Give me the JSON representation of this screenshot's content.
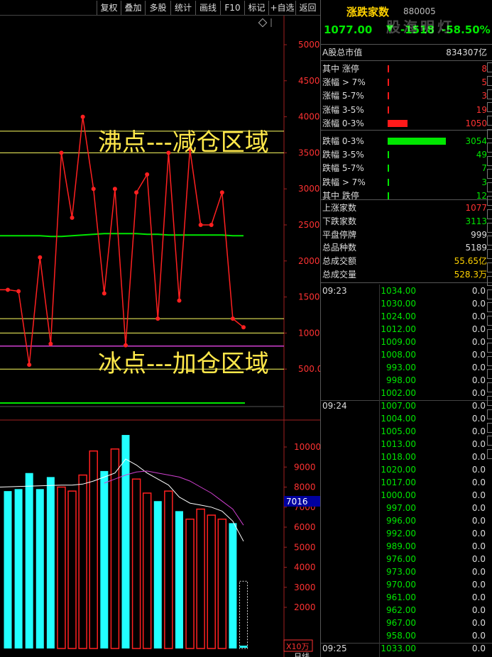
{
  "toolbar": {
    "buttons": [
      "复权",
      "叠加",
      "多股",
      "统计",
      "画线",
      "F10",
      "标记",
      "+自选",
      "返回"
    ]
  },
  "chart": {
    "upper_axis": [
      "5000",
      "4500",
      "4000",
      "3500",
      "3000",
      "2500",
      "2000",
      "1500",
      "1000",
      "500.0"
    ],
    "lower_axis": [
      "10000",
      "9000",
      "8000",
      "7000",
      "6000",
      "5000",
      "4000",
      "3000",
      "2000"
    ],
    "cursor_value": "7016",
    "lower_unit": "X10万",
    "boil_label": "沸点---减仓区域",
    "ice_label": "冰点---加仓区域",
    "bottom_corner": "日线",
    "diamond_icon": "diamond-icon",
    "colors": {
      "price_line": "#ff2020",
      "ma_line": "#00e600",
      "up_bar": "#ff2020",
      "down_bar": "#22ffff",
      "ref_line": "#ffff60",
      "ice_line": "#d040d0",
      "annotation": "#ffe84a"
    }
  },
  "chart_data": {
    "type": "line",
    "title": "",
    "price_series": [
      1600,
      1580,
      560,
      2050,
      850,
      3500,
      2600,
      4000,
      3000,
      1550,
      3000,
      830,
      2950,
      3200,
      1200,
      3500,
      1450,
      3550,
      2500,
      2500,
      2950,
      1200,
      1080
    ],
    "ma_series": [
      2350,
      2350,
      2350,
      2350,
      2340,
      2340,
      2350,
      2360,
      2370,
      2380,
      2380,
      2380,
      2380,
      2370,
      2370,
      2360,
      2360,
      2360,
      2360,
      2360,
      2360,
      2350,
      2350
    ],
    "ref_lines": [
      3800,
      3500,
      1200,
      1000,
      500
    ],
    "ice_line_value": 820,
    "upper_ylim": [
      0,
      5400
    ],
    "volume_bars": [
      {
        "v": 7800,
        "up": false
      },
      {
        "v": 7900,
        "up": false
      },
      {
        "v": 8700,
        "up": false
      },
      {
        "v": 7900,
        "up": false
      },
      {
        "v": 8500,
        "up": false
      },
      {
        "v": 8000,
        "up": true
      },
      {
        "v": 7800,
        "up": true
      },
      {
        "v": 8600,
        "up": true
      },
      {
        "v": 9800,
        "up": true
      },
      {
        "v": 8800,
        "up": false
      },
      {
        "v": 9900,
        "up": true
      },
      {
        "v": 10600,
        "up": false
      },
      {
        "v": 8400,
        "up": true
      },
      {
        "v": 7700,
        "up": true
      },
      {
        "v": 7300,
        "up": false
      },
      {
        "v": 7800,
        "up": true
      },
      {
        "v": 6800,
        "up": false
      },
      {
        "v": 6400,
        "up": true
      },
      {
        "v": 6900,
        "up": true
      },
      {
        "v": 6600,
        "up": true
      },
      {
        "v": 6400,
        "up": true
      },
      {
        "v": 6200,
        "up": false
      },
      {
        "v": 3300,
        "up": false
      }
    ],
    "vol_ma_white": [
      null,
      null,
      null,
      null,
      null,
      8100,
      8100,
      8150,
      8300,
      8500,
      8700,
      9400,
      9100,
      8700,
      8400,
      8100,
      7500,
      7200,
      7100,
      7000,
      6800,
      6300,
      5300
    ],
    "vol_ma_pink": [
      null,
      null,
      null,
      null,
      null,
      null,
      null,
      null,
      null,
      8200,
      8400,
      8600,
      8750,
      8800,
      8700,
      8600,
      8500,
      8300,
      8000,
      7700,
      7300,
      6900,
      6100
    ],
    "lower_ylim": [
      1000,
      11000
    ]
  },
  "panel": {
    "title": "涨跌家数",
    "code": "880005",
    "price": "1077.00",
    "arrow": "▼",
    "change": "-1518",
    "pct": "-58.50%",
    "watermark": "股海明灯",
    "market_cap_label": "A股总市值",
    "market_cap_value": "834307亿",
    "dist": [
      {
        "label": "其中 涨停",
        "value": "8",
        "color": "red",
        "bar": 2
      },
      {
        "label": "涨幅 > 7%",
        "value": "5",
        "color": "red",
        "bar": 2
      },
      {
        "label": "涨幅 5-7%",
        "value": "3",
        "color": "red",
        "bar": 2
      },
      {
        "label": "涨幅 3-5%",
        "value": "19",
        "color": "red",
        "bar": 2
      },
      {
        "label": "涨幅 0-3%",
        "value": "1050",
        "color": "red",
        "bar": 28
      },
      {
        "label": "跌幅 0-3%",
        "value": "3054",
        "color": "green",
        "bar": 82
      },
      {
        "label": "跌幅 3-5%",
        "value": "49",
        "color": "green",
        "bar": 2
      },
      {
        "label": "跌幅 5-7%",
        "value": "7",
        "color": "green",
        "bar": 2
      },
      {
        "label": "跌幅 > 7%",
        "value": "3",
        "color": "green",
        "bar": 2
      },
      {
        "label": "其中 跌停",
        "value": "12",
        "color": "green",
        "bar": 2
      }
    ],
    "stats": [
      {
        "label": "上涨家数",
        "value": "1077",
        "color": "red"
      },
      {
        "label": "下跌家数",
        "value": "3113",
        "color": "green"
      },
      {
        "label": "平盘停牌",
        "value": "999",
        "color": "white"
      },
      {
        "label": "总品种数",
        "value": "5189",
        "color": "white"
      },
      {
        "label": "总成交额",
        "value": "55.65亿",
        "color": "yellow"
      },
      {
        "label": "总成交量",
        "value": "528.3万",
        "color": "yellow"
      }
    ],
    "ticks": [
      {
        "time": "09:23",
        "rows": [
          [
            "1034.00",
            "0.0"
          ],
          [
            "1030.00",
            "0.0"
          ],
          [
            "1024.00",
            "0.0"
          ],
          [
            "1012.00",
            "0.0"
          ],
          [
            "1009.00",
            "0.0"
          ],
          [
            "1008.00",
            "0.0"
          ],
          [
            "993.00",
            "0.0"
          ],
          [
            "998.00",
            "0.0"
          ],
          [
            "1002.00",
            "0.0"
          ]
        ]
      },
      {
        "time": "09:24",
        "rows": [
          [
            "1007.00",
            "0.0"
          ],
          [
            "1004.00",
            "0.0"
          ],
          [
            "1005.00",
            "0.0"
          ],
          [
            "1013.00",
            "0.0"
          ],
          [
            "1018.00",
            "0.0"
          ],
          [
            "1020.00",
            "0.0"
          ],
          [
            "1017.00",
            "0.0"
          ],
          [
            "1000.00",
            "0.0"
          ],
          [
            "997.00",
            "0.0"
          ],
          [
            "996.00",
            "0.0"
          ],
          [
            "992.00",
            "0.0"
          ],
          [
            "989.00",
            "0.0"
          ],
          [
            "976.00",
            "0.0"
          ],
          [
            "973.00",
            "0.0"
          ],
          [
            "970.00",
            "0.0"
          ],
          [
            "961.00",
            "0.0"
          ],
          [
            "962.00",
            "0.0"
          ],
          [
            "967.00",
            "0.0"
          ],
          [
            "958.00",
            "0.0"
          ]
        ]
      },
      {
        "time": "09:25",
        "rows": [
          [
            "1033.00",
            "0.0"
          ]
        ]
      }
    ]
  }
}
